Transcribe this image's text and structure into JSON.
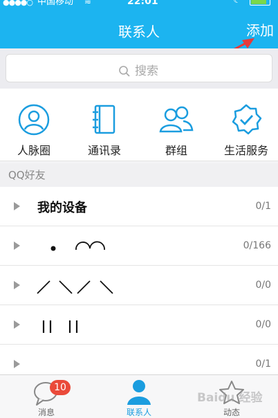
{
  "status": {
    "carrier": "中国移动",
    "time": "22:01",
    "signal": "●●●●○"
  },
  "header": {
    "title": "联系人",
    "add_label": "添加"
  },
  "search": {
    "placeholder": "搜索"
  },
  "quick_actions": [
    {
      "label": "人脉圈",
      "icon": "person-circle-icon"
    },
    {
      "label": "通讯录",
      "icon": "address-book-icon"
    },
    {
      "label": "群组",
      "icon": "group-icon"
    },
    {
      "label": "生活服务",
      "icon": "verified-badge-icon"
    }
  ],
  "section": {
    "title": "QQ好友"
  },
  "groups": [
    {
      "name": "我的设备",
      "count": "0/1"
    },
    {
      "name": "",
      "count": "0/166"
    },
    {
      "name": "",
      "count": "0/0"
    },
    {
      "name": "",
      "count": "0/0"
    },
    {
      "name": "",
      "count": "0/1"
    }
  ],
  "tabs": [
    {
      "label": "消息",
      "badge": "10"
    },
    {
      "label": "联系人"
    },
    {
      "label": "动态"
    }
  ],
  "watermark": "Baidu 经验",
  "colors": {
    "accent": "#1cb4f0",
    "badge": "#ea4a3a",
    "arrow": "#e63a3a"
  }
}
